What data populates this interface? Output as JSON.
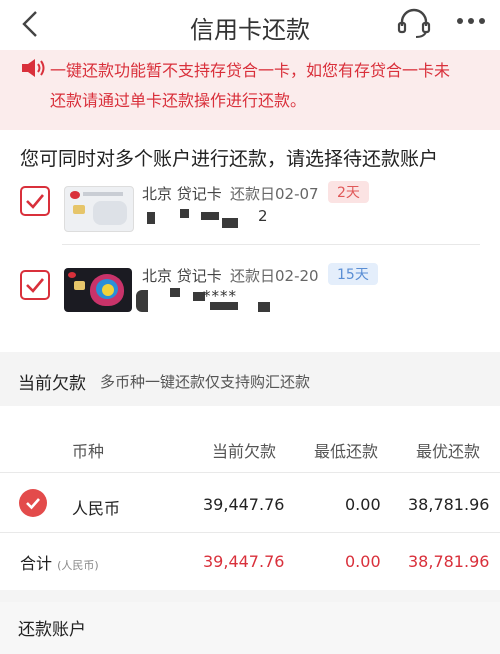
{
  "header": {
    "title": "信用卡还款",
    "back_icon": "chevron-left-icon",
    "service_icon": "headset-icon",
    "more_icon": "more-dots-icon"
  },
  "notice": {
    "line1": "一键还款功能暂不支持存贷合一卡，如您有存贷合一卡未",
    "line2": "还款请通过单卡还款操作进行还款。",
    "icon": "speaker-icon",
    "color": "#d9303b"
  },
  "accounts": {
    "heading": "您可同时对多个账户进行还款，请选择待还款账户",
    "cards": [
      {
        "bank": "北京",
        "type": "贷记卡",
        "due": "还款日02-07",
        "badge": "2天",
        "badge_color": "#e05858",
        "number_tail": "2",
        "checked": true
      },
      {
        "bank": "北京",
        "type": "贷记卡",
        "due": "还款日02-20",
        "badge": "15天",
        "badge_color": "#5a8ed4",
        "number_mid": "****",
        "checked": true
      }
    ]
  },
  "balance": {
    "title": "当前欠款",
    "subtitle": "多币种一键还款仅支持购汇还款",
    "columns": [
      "币种",
      "当前欠款",
      "最低还款",
      "最优还款"
    ],
    "rows": [
      {
        "currency": "人民币",
        "current": "39,447.76",
        "minimum": "0.00",
        "optimal": "38,781.96",
        "checked": true
      }
    ],
    "total": {
      "label": "合计",
      "unit": "(人民币)",
      "current": "39,447.76",
      "minimum": "0.00",
      "optimal": "38,781.96"
    }
  },
  "repay_account": {
    "title": "还款账户"
  }
}
